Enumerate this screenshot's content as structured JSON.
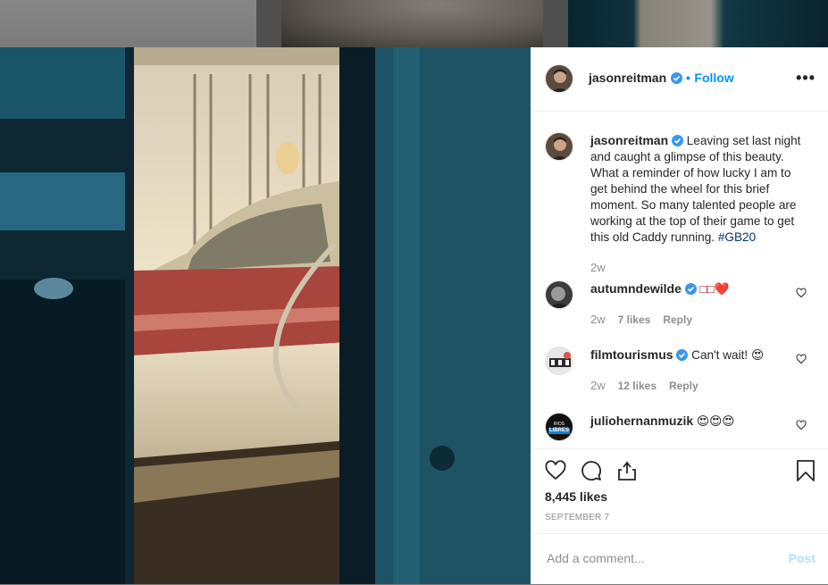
{
  "post": {
    "author": "jasonreitman",
    "follow_label": "Follow",
    "separator": "•",
    "more_label": "•••",
    "caption_text": "Leaving set last night and caught a glimpse of this beauty. What a reminder of how lucky I am to get behind the wheel for this brief moment. So many talented people are working at the top of their game to get this old Caddy running.",
    "hashtag": "#GB20",
    "caption_age": "2w",
    "likes": "8,445 likes",
    "date": "SEPTEMBER 7"
  },
  "comments": [
    {
      "user": "autumndewilde",
      "text": "□□❤️",
      "age": "2w",
      "likes": "7 likes",
      "reply": "Reply",
      "verified": true
    },
    {
      "user": "filmtourismus",
      "text": "Can't wait! 😍",
      "age": "2w",
      "likes": "12 likes",
      "reply": "Reply",
      "verified": true
    },
    {
      "user": "juliohernanmuzik",
      "text": "😍😍😍",
      "verified": false
    }
  ],
  "avatar_badge": {
    "line1": "RIOS",
    "line2": "LIBRES"
  },
  "add_comment": {
    "placeholder": "Add a comment...",
    "post_label": "Post"
  },
  "colors": {
    "accent": "#0095f6",
    "verified": "#3897f0",
    "hashtag": "#00376b",
    "muted": "#8e8e8e"
  },
  "icons": [
    "verified-badge-icon",
    "more-options-icon",
    "heart-icon",
    "comment-icon",
    "share-icon",
    "bookmark-icon"
  ]
}
